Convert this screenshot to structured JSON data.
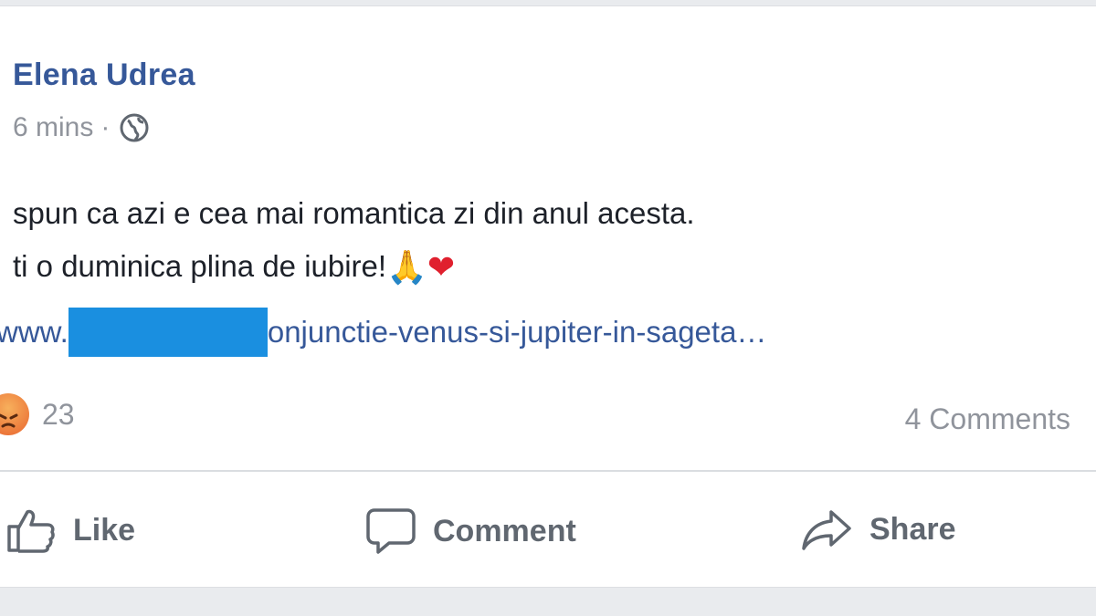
{
  "post": {
    "author": "Elena Udrea",
    "time": "6 mins",
    "separator": "·",
    "line1": "spun ca azi e cea mai romantica zi din anul acesta.",
    "line2": "ti o duminica plina de iubire!",
    "emoji_pray": "🙏",
    "emoji_heart": "❤",
    "link_prefix": "www.",
    "link_suffix": "onjunctie-venus-si-jupiter-in-sageta…"
  },
  "stats": {
    "reaction_count": "23",
    "comments": "4 Comments"
  },
  "actions": {
    "like": "Like",
    "comment": "Comment",
    "share": "Share"
  },
  "icons": {
    "privacy": "globe-icon",
    "reaction": "angry-reaction-icon",
    "like": "thumbs-up-icon",
    "comment": "speech-bubble-icon",
    "share": "share-arrow-icon"
  },
  "colors": {
    "author": "#365899",
    "link": "#365899",
    "redaction": "#1a8fe0",
    "muted": "#90949c",
    "action": "#606770"
  }
}
